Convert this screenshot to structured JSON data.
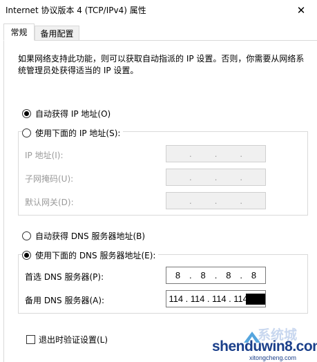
{
  "window": {
    "title": "Internet 协议版本 4 (TCP/IPv4) 属性",
    "close_glyph": "✕"
  },
  "tabs": [
    {
      "label": "常规",
      "active": true
    },
    {
      "label": "备用配置",
      "active": false
    }
  ],
  "description": "如果网络支持此功能，则可以获取自动指派的 IP 设置。否则，你需要从网络系统管理员处获得适当的 IP 设置。",
  "ip_section": {
    "auto_label": "自动获得 IP 地址(O)",
    "auto_selected": true,
    "manual_label": "使用下面的 IP 地址(S):",
    "manual_selected": false,
    "fields": [
      {
        "label": "IP 地址(I):",
        "octets": [
          "",
          "",
          "",
          ""
        ]
      },
      {
        "label": "子网掩码(U):",
        "octets": [
          "",
          "",
          "",
          ""
        ]
      },
      {
        "label": "默认网关(D):",
        "octets": [
          "",
          "",
          "",
          ""
        ]
      }
    ]
  },
  "dns_section": {
    "auto_label": "自动获得 DNS 服务器地址(B)",
    "auto_selected": false,
    "manual_label": "使用下面的 DNS 服务器地址(E):",
    "manual_selected": true,
    "fields": [
      {
        "label": "首选 DNS 服务器(P):",
        "octets": [
          "8",
          "8",
          "8",
          "8"
        ]
      },
      {
        "label": "备用 DNS 服务器(A):",
        "octets": [
          "114",
          "114",
          "114",
          "114"
        ]
      }
    ]
  },
  "validate_on_exit": {
    "label": "退出时验证设置(L)",
    "checked": false
  },
  "watermark": {
    "main": "shenduwin8.com",
    "sub": "xitongcheng.com",
    "cn": "系统城"
  },
  "colors": {
    "watermark_blue": "#1a3f8a",
    "border": "#d9d9d9",
    "disabled_text": "#9a9a9a"
  }
}
